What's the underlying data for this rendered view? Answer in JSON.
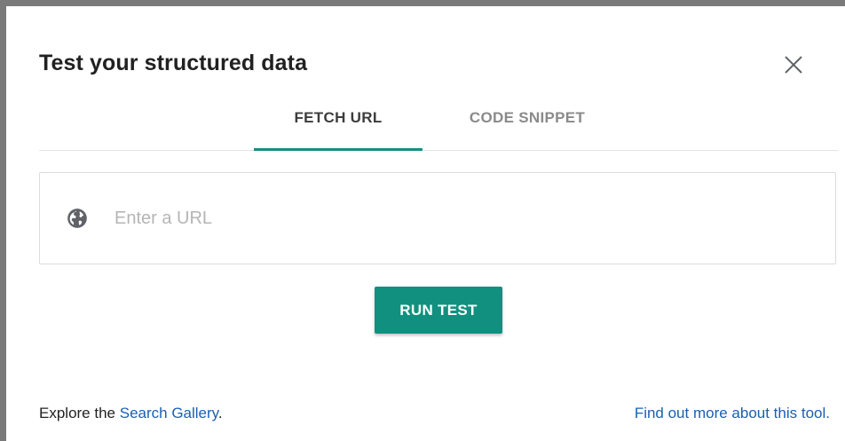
{
  "dialog": {
    "title": "Test your structured data"
  },
  "tabs": [
    {
      "label": "FETCH URL",
      "active": true
    },
    {
      "label": "CODE SNIPPET",
      "active": false
    }
  ],
  "url_input": {
    "value": "",
    "placeholder": "Enter a URL",
    "icon": "globe-icon"
  },
  "run_button": {
    "label": "RUN TEST"
  },
  "footer": {
    "explore_prefix": "Explore the ",
    "search_gallery_link": "Search Gallery",
    "explore_suffix": ".",
    "find_out_link": "Find out more about this tool."
  },
  "colors": {
    "accent": "#12907f",
    "link": "#1a5fb4"
  }
}
